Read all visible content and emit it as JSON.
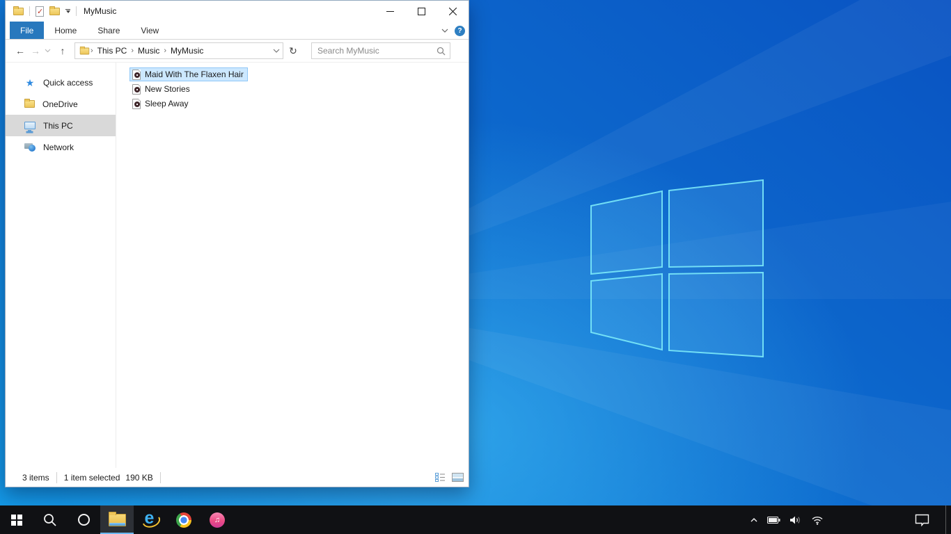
{
  "titlebar": {
    "title": "MyMusic"
  },
  "ribbon": {
    "tabs": {
      "file": "File",
      "home": "Home",
      "share": "Share",
      "view": "View"
    }
  },
  "navigation": {
    "breadcrumb": {
      "items": [
        "This PC",
        "Music",
        "MyMusic"
      ]
    }
  },
  "search": {
    "placeholder": "Search MyMusic"
  },
  "sidebar": {
    "items": [
      {
        "label": "Quick access",
        "icon": "quick-access-star",
        "selected": false
      },
      {
        "label": "OneDrive",
        "icon": "onedrive-folder",
        "selected": false
      },
      {
        "label": "This PC",
        "icon": "this-pc-monitor",
        "selected": true
      },
      {
        "label": "Network",
        "icon": "network-globe",
        "selected": false
      }
    ]
  },
  "files": {
    "items": [
      {
        "name": "Maid With The Flaxen Hair",
        "type": "audio",
        "selected": true
      },
      {
        "name": "New Stories",
        "type": "audio",
        "selected": false
      },
      {
        "name": "Sleep Away",
        "type": "audio",
        "selected": false
      }
    ]
  },
  "statusbar": {
    "items_count": "3 items",
    "selected_count": "1 item selected",
    "selected_size": "190 KB"
  },
  "icons": {
    "back": "←",
    "forward": "→",
    "up": "↑",
    "refresh": "↻",
    "star": "★",
    "check": "✓",
    "help": "?",
    "separator": "›",
    "music_note": "♫"
  },
  "colors": {
    "accent_tab": "#2878bd",
    "selection_bg": "#cce8ff",
    "selection_border": "#8fc7f7",
    "sidebar_selected_bg": "#d9d9d9",
    "taskbar_bg": "#101114",
    "active_underline": "#6cb8f0"
  }
}
